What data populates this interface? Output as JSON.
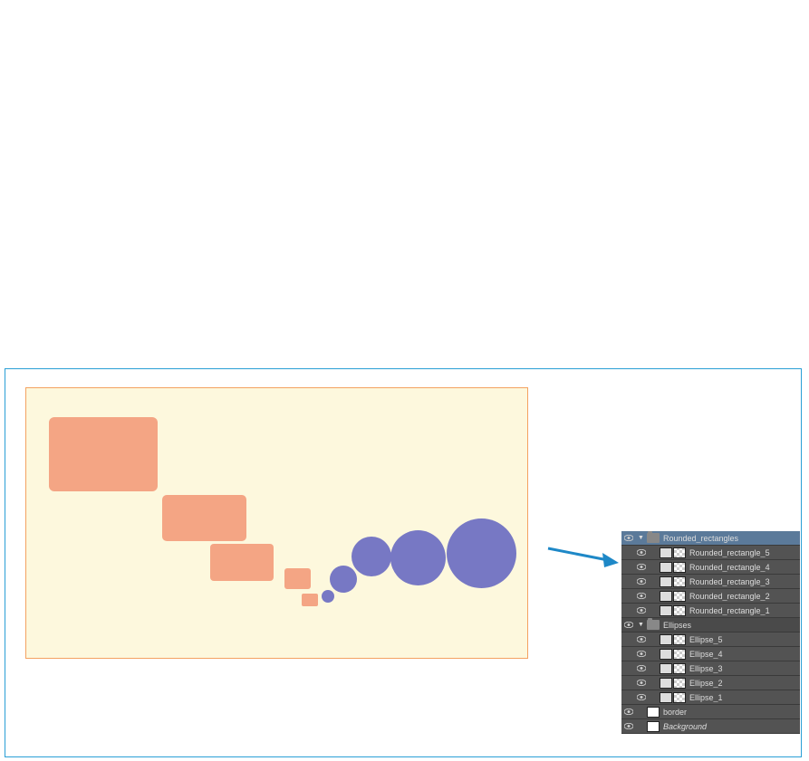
{
  "layers": {
    "group_rr": "Rounded_rectangles",
    "rr5": "Rounded_rectangle_5",
    "rr4": "Rounded_rectangle_4",
    "rr3": "Rounded_rectangle_3",
    "rr2": "Rounded_rectangle_2",
    "rr1": "Rounded_rectangle_1",
    "group_el": "Ellipses",
    "e5": "Ellipse_5",
    "e4": "Ellipse_4",
    "e3": "Ellipse_3",
    "e2": "Ellipse_2",
    "e1": "Ellipse_1",
    "border": "border",
    "bg": "Background"
  },
  "colors": {
    "rect": "#f4a584",
    "ellipse": "#7778c4",
    "canvas": "#fdf8dd",
    "border": "#2a9fd6",
    "arrow": "#1e88c7"
  },
  "disclosure_open": "▼"
}
